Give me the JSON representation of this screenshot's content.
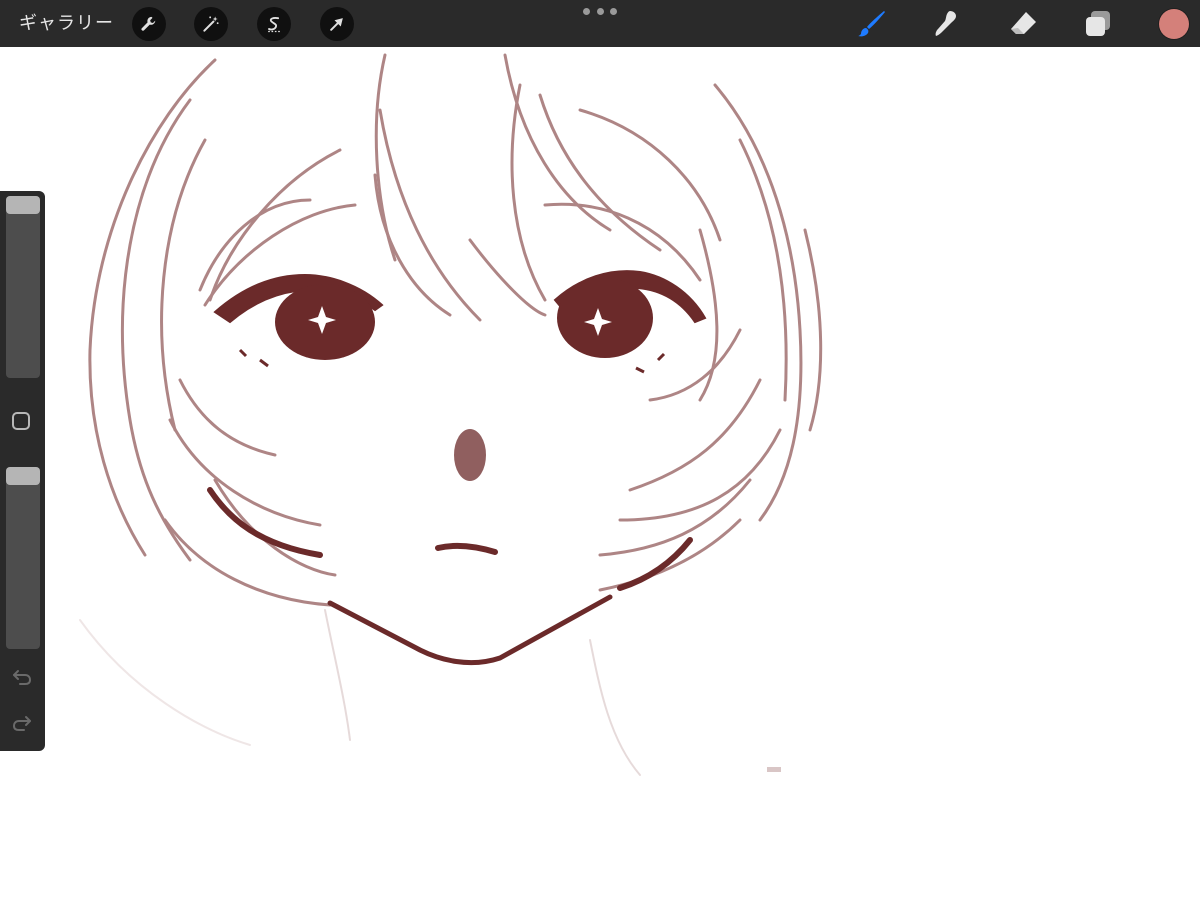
{
  "toolbar": {
    "gallery_label": "ギャラリー",
    "left_tools": [
      {
        "name": "actions",
        "icon": "wrench-icon"
      },
      {
        "name": "adjustments",
        "icon": "magic-wand-icon"
      },
      {
        "name": "selection",
        "icon": "selection-s-icon"
      },
      {
        "name": "transform",
        "icon": "arrow-cursor-icon"
      }
    ],
    "right_tools": [
      {
        "name": "brush",
        "icon": "brush-icon",
        "active": true
      },
      {
        "name": "smudge",
        "icon": "smudge-finger-icon",
        "active": false
      },
      {
        "name": "eraser",
        "icon": "eraser-icon",
        "active": false
      },
      {
        "name": "layers",
        "icon": "layers-icon",
        "active": false
      }
    ],
    "current_color": "#d4807a",
    "active_tool_color": "#1e7bff"
  },
  "sidebar": {
    "brush_size_level": 1.0,
    "opacity_level": 1.0,
    "modify_button_icon": "square-icon",
    "undo_icon": "undo-icon",
    "redo_icon": "redo-icon"
  },
  "canvas": {
    "ink_color": "#6b2a2a",
    "sketch_color": "#a07070",
    "background": "#ffffff"
  }
}
